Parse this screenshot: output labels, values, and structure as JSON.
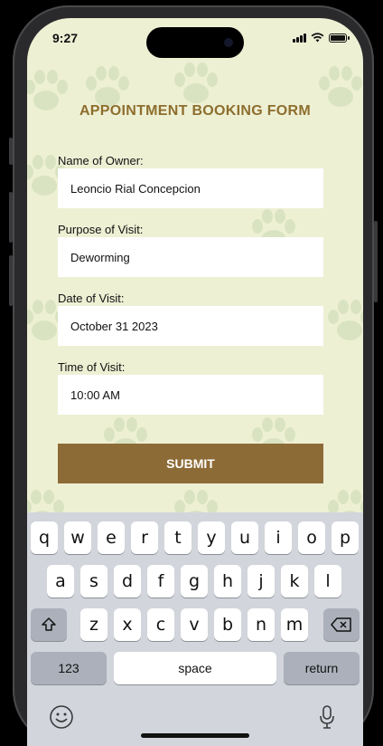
{
  "status_bar": {
    "time": "9:27"
  },
  "form": {
    "title": "APPOINTMENT BOOKING FORM",
    "fields": [
      {
        "label": "Name of Owner:",
        "value": "Leoncio Rial Concepcion"
      },
      {
        "label": "Purpose of Visit:",
        "value": "Deworming"
      },
      {
        "label": "Date of Visit:",
        "value": "October 31 2023"
      },
      {
        "label": "Time of Visit:",
        "value": "10:00 AM"
      }
    ],
    "submit_label": "SUBMIT"
  },
  "keyboard": {
    "row1": [
      "q",
      "w",
      "e",
      "r",
      "t",
      "y",
      "u",
      "i",
      "o",
      "p"
    ],
    "row2": [
      "a",
      "s",
      "d",
      "f",
      "g",
      "h",
      "j",
      "k",
      "l"
    ],
    "row3": [
      "z",
      "x",
      "c",
      "v",
      "b",
      "n",
      "m"
    ],
    "numbers_label": "123",
    "space_label": "space",
    "return_label": "return"
  },
  "colors": {
    "background": "#eef0d4",
    "paw": "#c6d8b0",
    "title": "#8d6e2e",
    "submit": "#8d6b36"
  }
}
